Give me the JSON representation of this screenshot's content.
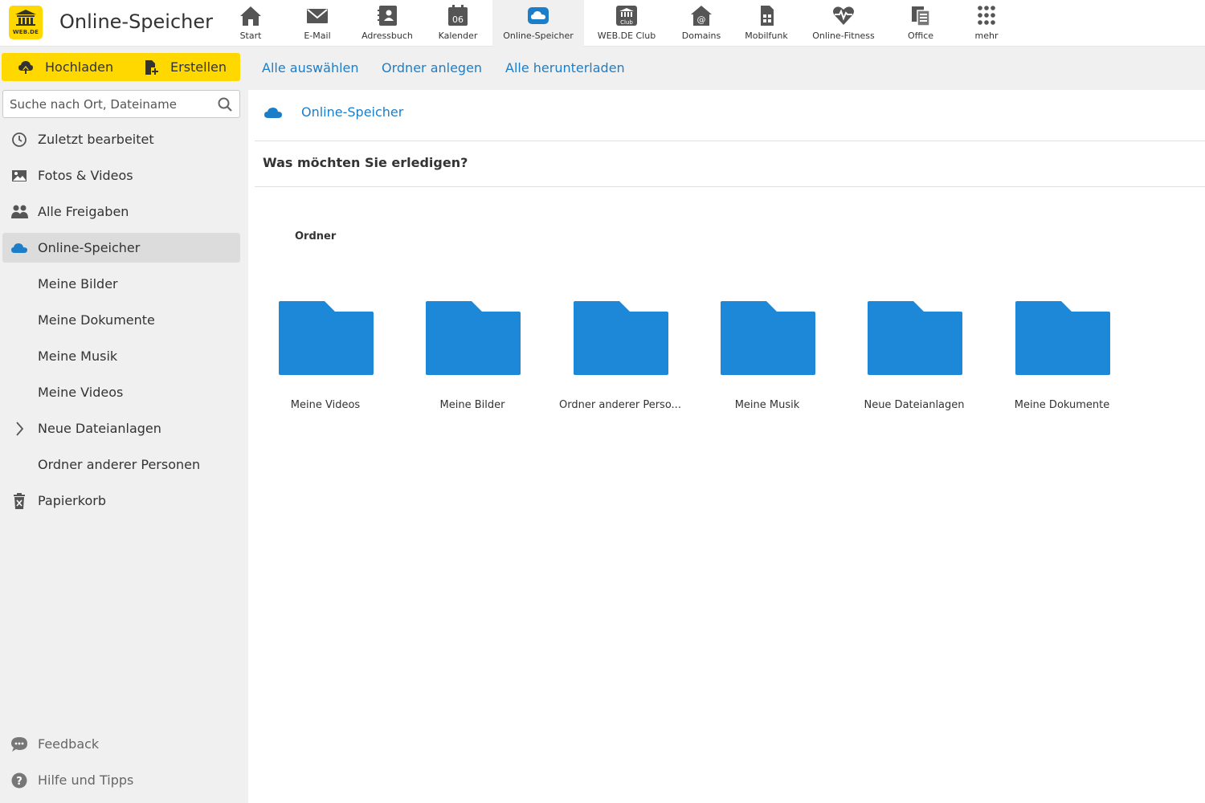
{
  "app": {
    "logo_text": "WEB.DE",
    "title": "Online-Speicher"
  },
  "topnav": [
    {
      "label": "Start",
      "icon": "home-icon"
    },
    {
      "label": "E-Mail",
      "icon": "mail-icon"
    },
    {
      "label": "Adressbuch",
      "icon": "address-book-icon"
    },
    {
      "label": "Kalender",
      "icon": "calendar-icon",
      "badge": "06"
    },
    {
      "label": "Online-Speicher",
      "icon": "cloud-icon",
      "active": true
    },
    {
      "label": "WEB.DE Club",
      "icon": "club-icon"
    },
    {
      "label": "Domains",
      "icon": "domain-icon"
    },
    {
      "label": "Mobilfunk",
      "icon": "sim-card-icon"
    },
    {
      "label": "Online-Fitness",
      "icon": "heart-pulse-icon"
    },
    {
      "label": "Office",
      "icon": "office-icon"
    },
    {
      "label": "mehr",
      "icon": "grid-icon"
    }
  ],
  "sidebar": {
    "upload_label": "Hochladen",
    "create_label": "Erstellen",
    "search_placeholder": "Suche nach Ort, Dateiname",
    "items": [
      {
        "label": "Zuletzt bearbeitet",
        "icon": "clock-icon"
      },
      {
        "label": "Fotos & Videos",
        "icon": "image-icon"
      },
      {
        "label": "Alle Freigaben",
        "icon": "people-icon"
      },
      {
        "label": "Online-Speicher",
        "icon": "cloud-icon",
        "active": true
      },
      {
        "label": "Meine Bilder"
      },
      {
        "label": "Meine Dokumente"
      },
      {
        "label": "Meine Musik"
      },
      {
        "label": "Meine Videos"
      },
      {
        "label": "Neue Dateianlagen",
        "icon": "chevron-right-icon"
      },
      {
        "label": "Ordner anderer Personen"
      },
      {
        "label": "Papierkorb",
        "icon": "trash-icon"
      }
    ],
    "footer": [
      {
        "label": "Feedback",
        "icon": "chat-icon"
      },
      {
        "label": "Hilfe und Tipps",
        "icon": "help-icon"
      }
    ]
  },
  "actions": {
    "select_all": "Alle auswählen",
    "new_folder": "Ordner anlegen",
    "download_all": "Alle herunterladen"
  },
  "breadcrumb": {
    "label": "Online-Speicher"
  },
  "question": "Was möchten Sie erledigen?",
  "folders_title": "Ordner",
  "folders": [
    "Meine Videos",
    "Meine Bilder",
    "Ordner anderer Perso...",
    "Meine Musik",
    "Neue Dateianlagen",
    "Meine Dokumente"
  ],
  "colors": {
    "accent_yellow": "#ffd800",
    "link_blue": "#1c7ec9",
    "folder_blue": "#1e88d8",
    "sidebar_bg": "#f0f0f0"
  }
}
